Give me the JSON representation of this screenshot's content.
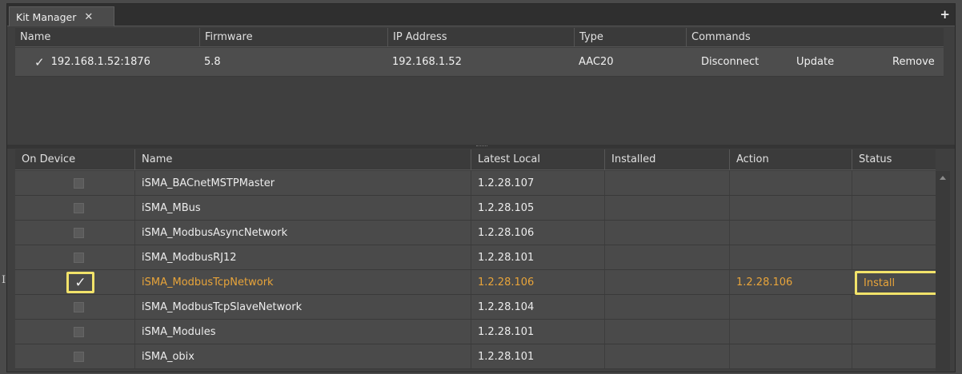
{
  "window": {
    "tab_title": "Kit Manager",
    "close_glyph": "✕",
    "plus_glyph": "+"
  },
  "connection_table": {
    "headers": [
      "Name",
      "Firmware",
      "IP Address",
      "Type",
      "Commands"
    ],
    "row": {
      "name": "192.168.1.52:1876",
      "firmware": "5.8",
      "ip": "192.168.1.52",
      "type": "AAC20",
      "commands": [
        "Disconnect",
        "Update",
        "Remove"
      ]
    }
  },
  "kits_table": {
    "headers": [
      "On Device",
      "Name",
      "Latest Local",
      "Installed",
      "Action",
      "Status"
    ],
    "rows": [
      {
        "on_device": false,
        "name": "iSMA_BACnetMSTPMaster",
        "latest_local": "1.2.28.107",
        "installed": "",
        "action": "",
        "status": ""
      },
      {
        "on_device": false,
        "name": "iSMA_MBus",
        "latest_local": "1.2.28.105",
        "installed": "",
        "action": "",
        "status": ""
      },
      {
        "on_device": false,
        "name": "iSMA_ModbusAsyncNetwork",
        "latest_local": "1.2.28.106",
        "installed": "",
        "action": "",
        "status": ""
      },
      {
        "on_device": false,
        "name": "iSMA_ModbusRJ12",
        "latest_local": "1.2.28.101",
        "installed": "",
        "action": "",
        "status": ""
      },
      {
        "on_device": true,
        "name": "iSMA_ModbusTcpNetwork",
        "latest_local": "1.2.28.106",
        "installed": "",
        "action": "1.2.28.106",
        "status": "Install"
      },
      {
        "on_device": false,
        "name": "iSMA_ModbusTcpSlaveNetwork",
        "latest_local": "1.2.28.104",
        "installed": "",
        "action": "",
        "status": ""
      },
      {
        "on_device": false,
        "name": "iSMA_Modules",
        "latest_local": "1.2.28.101",
        "installed": "",
        "action": "",
        "status": ""
      },
      {
        "on_device": false,
        "name": "iSMA_obix",
        "latest_local": "1.2.28.101",
        "installed": "",
        "action": "",
        "status": ""
      }
    ]
  },
  "icons": {
    "check": "✓",
    "text_cursor": "I"
  },
  "colors": {
    "highlight_border": "#f2e36a",
    "selected_text": "#e8a43a"
  }
}
